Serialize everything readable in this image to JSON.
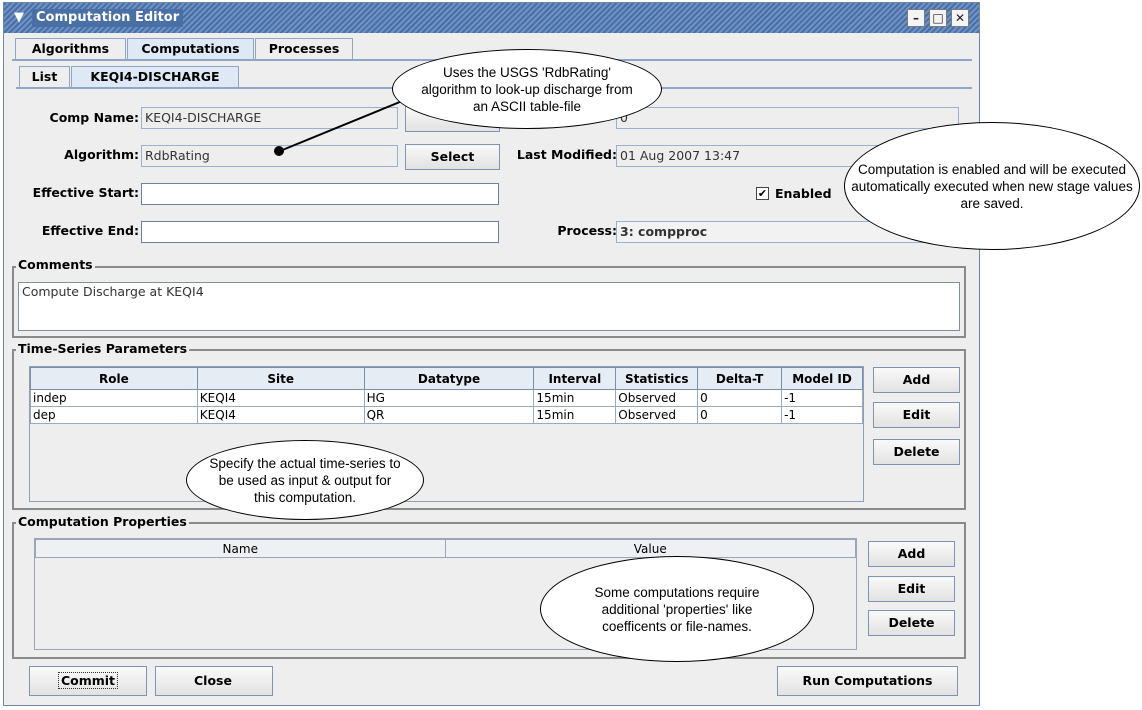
{
  "window": {
    "title": "Computation Editor"
  },
  "top_tabs": [
    "Algorithms",
    "Computations",
    "Processes"
  ],
  "sub_tabs": [
    "List",
    "KEQI4-DISCHARGE"
  ],
  "form": {
    "comp_name_label": "Comp Name:",
    "comp_name_value": "KEQI4-DISCHARGE",
    "algorithm_label": "Algorithm:",
    "algorithm_value": "RdbRating",
    "select_label": "Select",
    "last_modified_label": "Last Modified:",
    "last_modified_value": "01 Aug 2007 13:47",
    "hidden_field_value": "0",
    "effective_start_label": "Effective Start:",
    "effective_start_value": "",
    "effective_end_label": "Effective End:",
    "effective_end_value": "",
    "enabled_label": "Enabled",
    "enabled_checked": true,
    "process_label": "Process:",
    "process_value": "3: compproc"
  },
  "comments": {
    "title": "Comments",
    "text": "Compute Discharge at KEQI4"
  },
  "ts_params": {
    "title": "Time-Series Parameters",
    "columns": [
      "Role",
      "Site",
      "Datatype",
      "Interval",
      "Statistics",
      "Delta-T",
      "Model ID"
    ],
    "rows": [
      [
        "indep",
        "KEQI4",
        "HG",
        "15min",
        "Observed",
        "0",
        "-1"
      ],
      [
        "dep",
        "KEQI4",
        "QR",
        "15min",
        "Observed",
        "0",
        "-1"
      ]
    ],
    "buttons": [
      "Add",
      "Edit",
      "Delete"
    ]
  },
  "comp_props": {
    "title": "Computation Properties",
    "columns": [
      "Name",
      "Value"
    ],
    "buttons": [
      "Add",
      "Edit",
      "Delete"
    ]
  },
  "bottom": {
    "commit": "Commit",
    "close": "Close",
    "run": "Run Computations"
  },
  "callouts": {
    "algorithm": "Uses the USGS 'RdbRating' algorithm to look-up discharge from an ASCII table-file",
    "enabled": "Computation is enabled and will be executed automatically executed when new stage values are saved.",
    "timeseries": "Specify the actual time-series to be used as input & output for this computation.",
    "properties": "Some computations require additional 'properties' like coefficents or file-names."
  }
}
